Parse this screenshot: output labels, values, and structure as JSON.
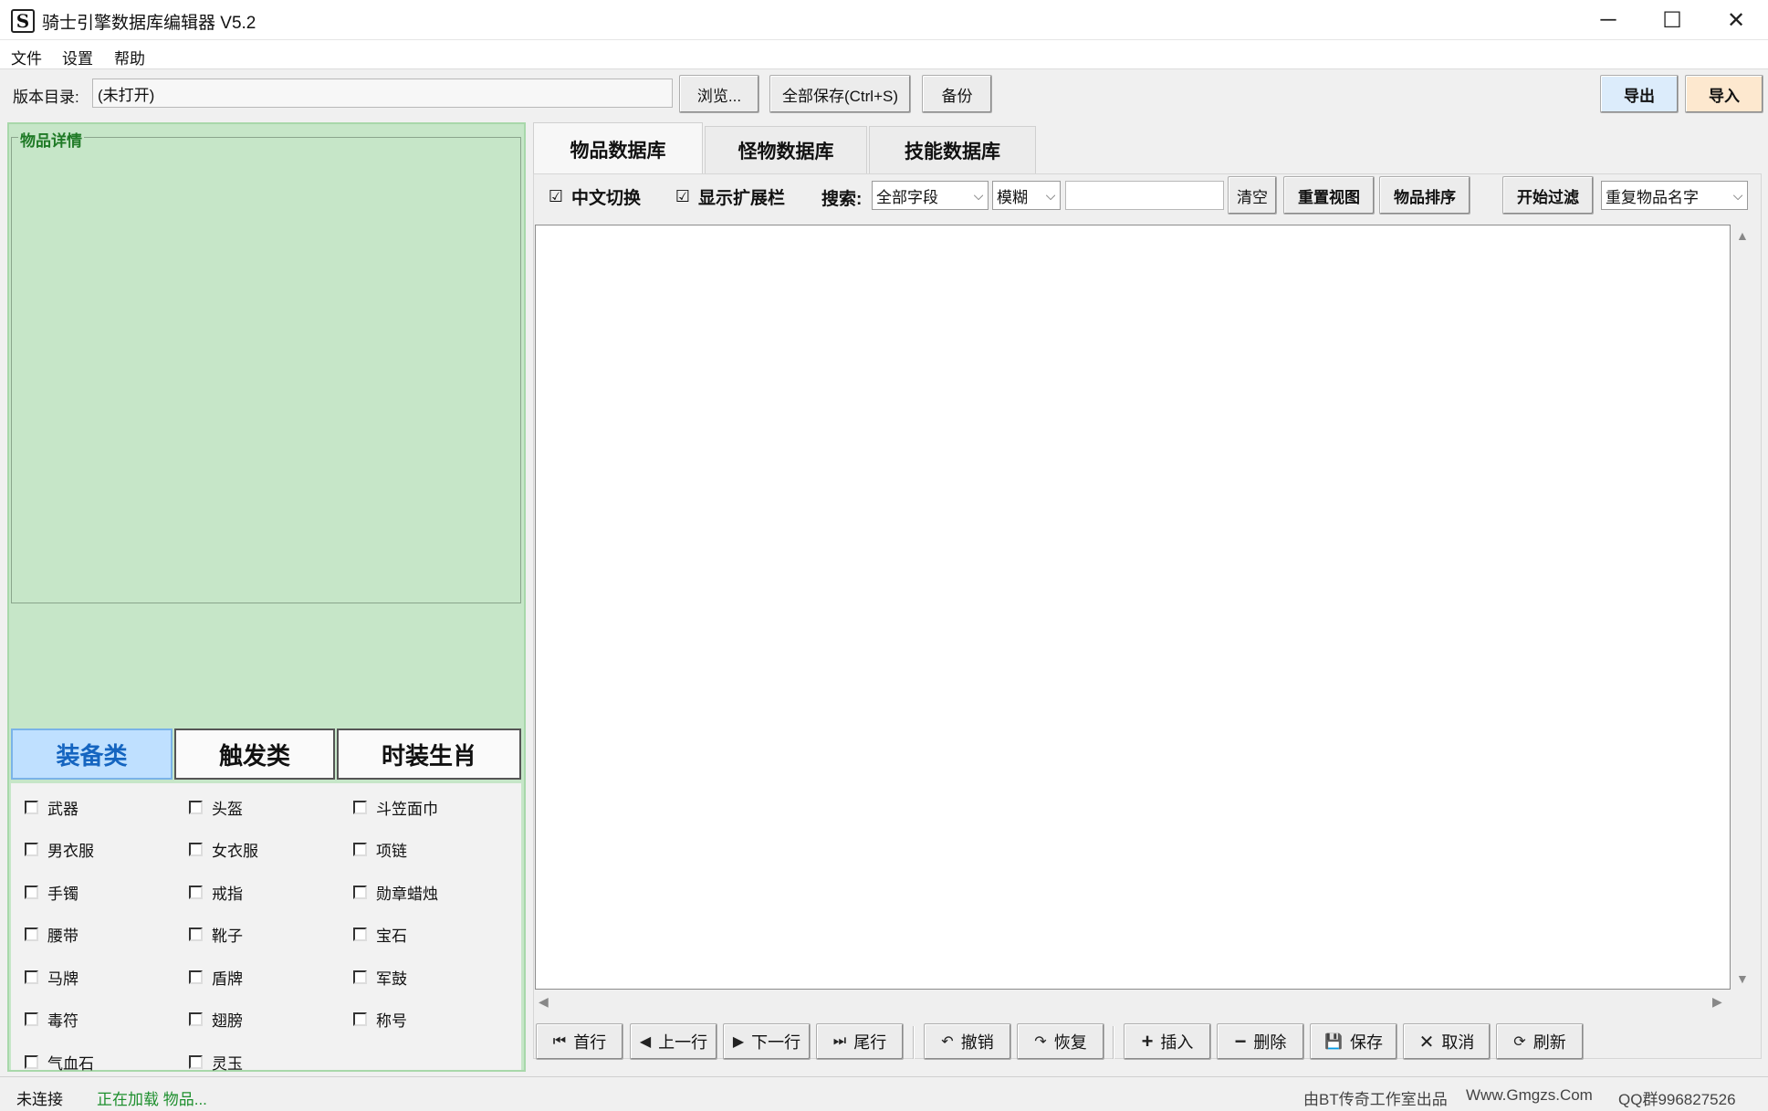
{
  "window": {
    "title": "骑士引擎数据库编辑器 V5.2",
    "icon_char": "S",
    "controls": {
      "minimize": "─",
      "maximize": "☐",
      "close": "✕"
    }
  },
  "menu": [
    "文件",
    "设置",
    "帮助"
  ],
  "toolbar": {
    "dir_label": "版本目录:",
    "dir_value": "(未打开)",
    "browse": "浏览...",
    "save_all": "全部保存(Ctrl+S)",
    "backup": "备份",
    "export": "导出",
    "import": "导入"
  },
  "left_panel": {
    "details_title": "物品详情",
    "category_tabs": [
      "装备类",
      "触发类",
      "时装生肖"
    ],
    "active_category": 0,
    "checkboxes": [
      [
        "武器",
        "头盔",
        "斗笠面巾"
      ],
      [
        "男衣服",
        "女衣服",
        "项链"
      ],
      [
        "手镯",
        "戒指",
        "勋章蜡烛"
      ],
      [
        "腰带",
        "靴子",
        "宝石"
      ],
      [
        "马牌",
        "盾牌",
        "军鼓"
      ],
      [
        "毒符",
        "翅膀",
        "称号"
      ],
      [
        "气血石",
        "灵玉",
        ""
      ]
    ]
  },
  "db_tabs": [
    "物品数据库",
    "怪物数据库",
    "技能数据库"
  ],
  "active_db_tab": 0,
  "filter_bar": {
    "chinese_toggle": {
      "label": "中文切换",
      "checked": true,
      "mark": "☑"
    },
    "show_ext": {
      "label": "显示扩展栏",
      "checked": true,
      "mark": "☑"
    },
    "search_label": "搜索:",
    "field_select": "全部字段",
    "mode_select": "模糊",
    "search_text": "",
    "clear": "清空",
    "reset_view": "重置视图",
    "sort_items": "物品排序",
    "start_filter": "开始过滤",
    "filter_select": "重复物品名字"
  },
  "nav_buttons": [
    {
      "icon": "⏮",
      "label": "首行"
    },
    {
      "icon": "◀",
      "label": "上一行"
    },
    {
      "icon": "▶",
      "label": "下一行"
    },
    {
      "icon": "⏭",
      "label": "尾行"
    },
    {
      "icon": "↶",
      "label": "撤销"
    },
    {
      "icon": "↷",
      "label": "恢复"
    },
    {
      "icon": "+",
      "label": "插入"
    },
    {
      "icon": "−",
      "label": "删除"
    },
    {
      "icon": "💾",
      "label": "保存"
    },
    {
      "icon": "✕",
      "label": "取消"
    },
    {
      "icon": "⟳",
      "label": "刷新"
    }
  ],
  "status": {
    "connection": "未连接",
    "loading": "正在加载 物品...",
    "credit": "由BT传奇工作室出品",
    "website": "Www.Gmgzs.Com",
    "qq": "QQ群996827526"
  },
  "colors": {
    "left_panel_bg": "#c6e6c8",
    "active_tab_bg": "#bfe0ff",
    "active_tab_text": "#1565c0",
    "loading_text": "#1e8f2e",
    "export_bg": "#dcecfb",
    "import_bg": "#fde8cf"
  }
}
